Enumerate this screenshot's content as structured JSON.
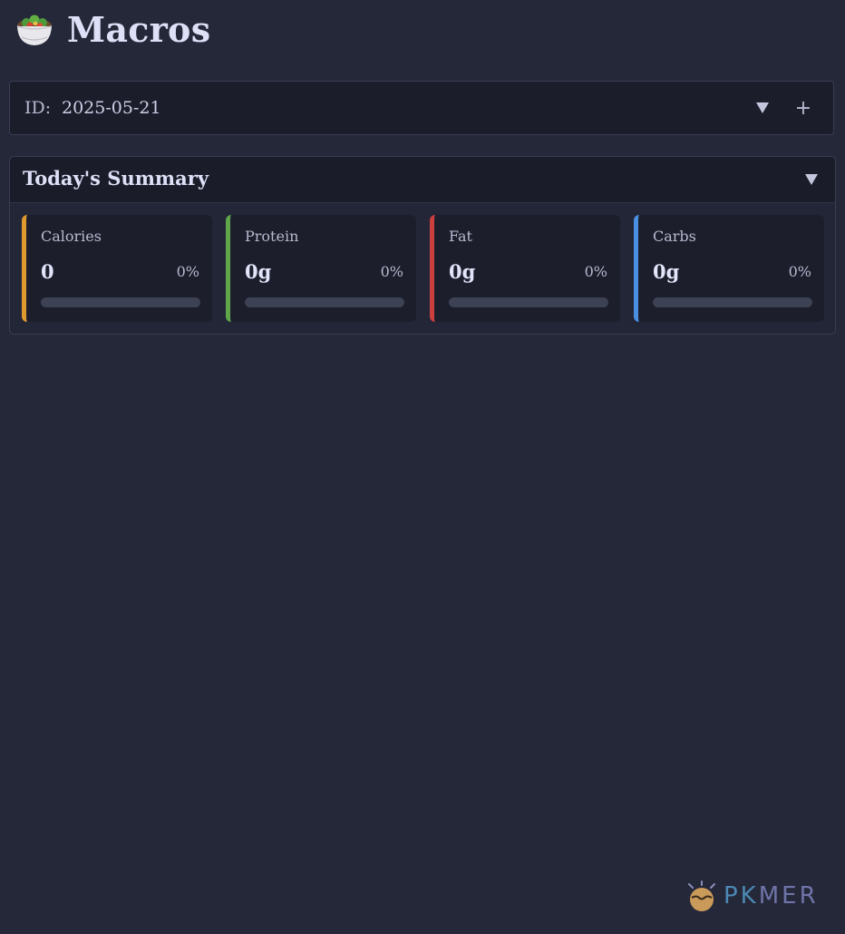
{
  "header": {
    "title": "Macros",
    "icon": "salad-bowl-icon"
  },
  "id_bar": {
    "label": "ID:",
    "value": "2025-05-21",
    "dropdown_icon": "triangle-down-icon",
    "add_label": "+"
  },
  "summary": {
    "title": "Today's Summary",
    "toggle_icon": "triangle-down-icon",
    "cards": [
      {
        "label": "Calories",
        "value": "0",
        "percent": "0%",
        "progress": 0,
        "color": "#e0992f"
      },
      {
        "label": "Protein",
        "value": "0g",
        "percent": "0%",
        "progress": 0,
        "color": "#5fa64a"
      },
      {
        "label": "Fat",
        "value": "0g",
        "percent": "0%",
        "progress": 0,
        "color": "#cc3f3f"
      },
      {
        "label": "Carbs",
        "value": "0g",
        "percent": "0%",
        "progress": 0,
        "color": "#4a90e2"
      }
    ]
  },
  "watermark": {
    "text_pk": "PK",
    "text_mer": "MER"
  },
  "colors": {
    "background": "#252839",
    "panel": "#1b1d2b",
    "text": "#d3d6ec"
  }
}
